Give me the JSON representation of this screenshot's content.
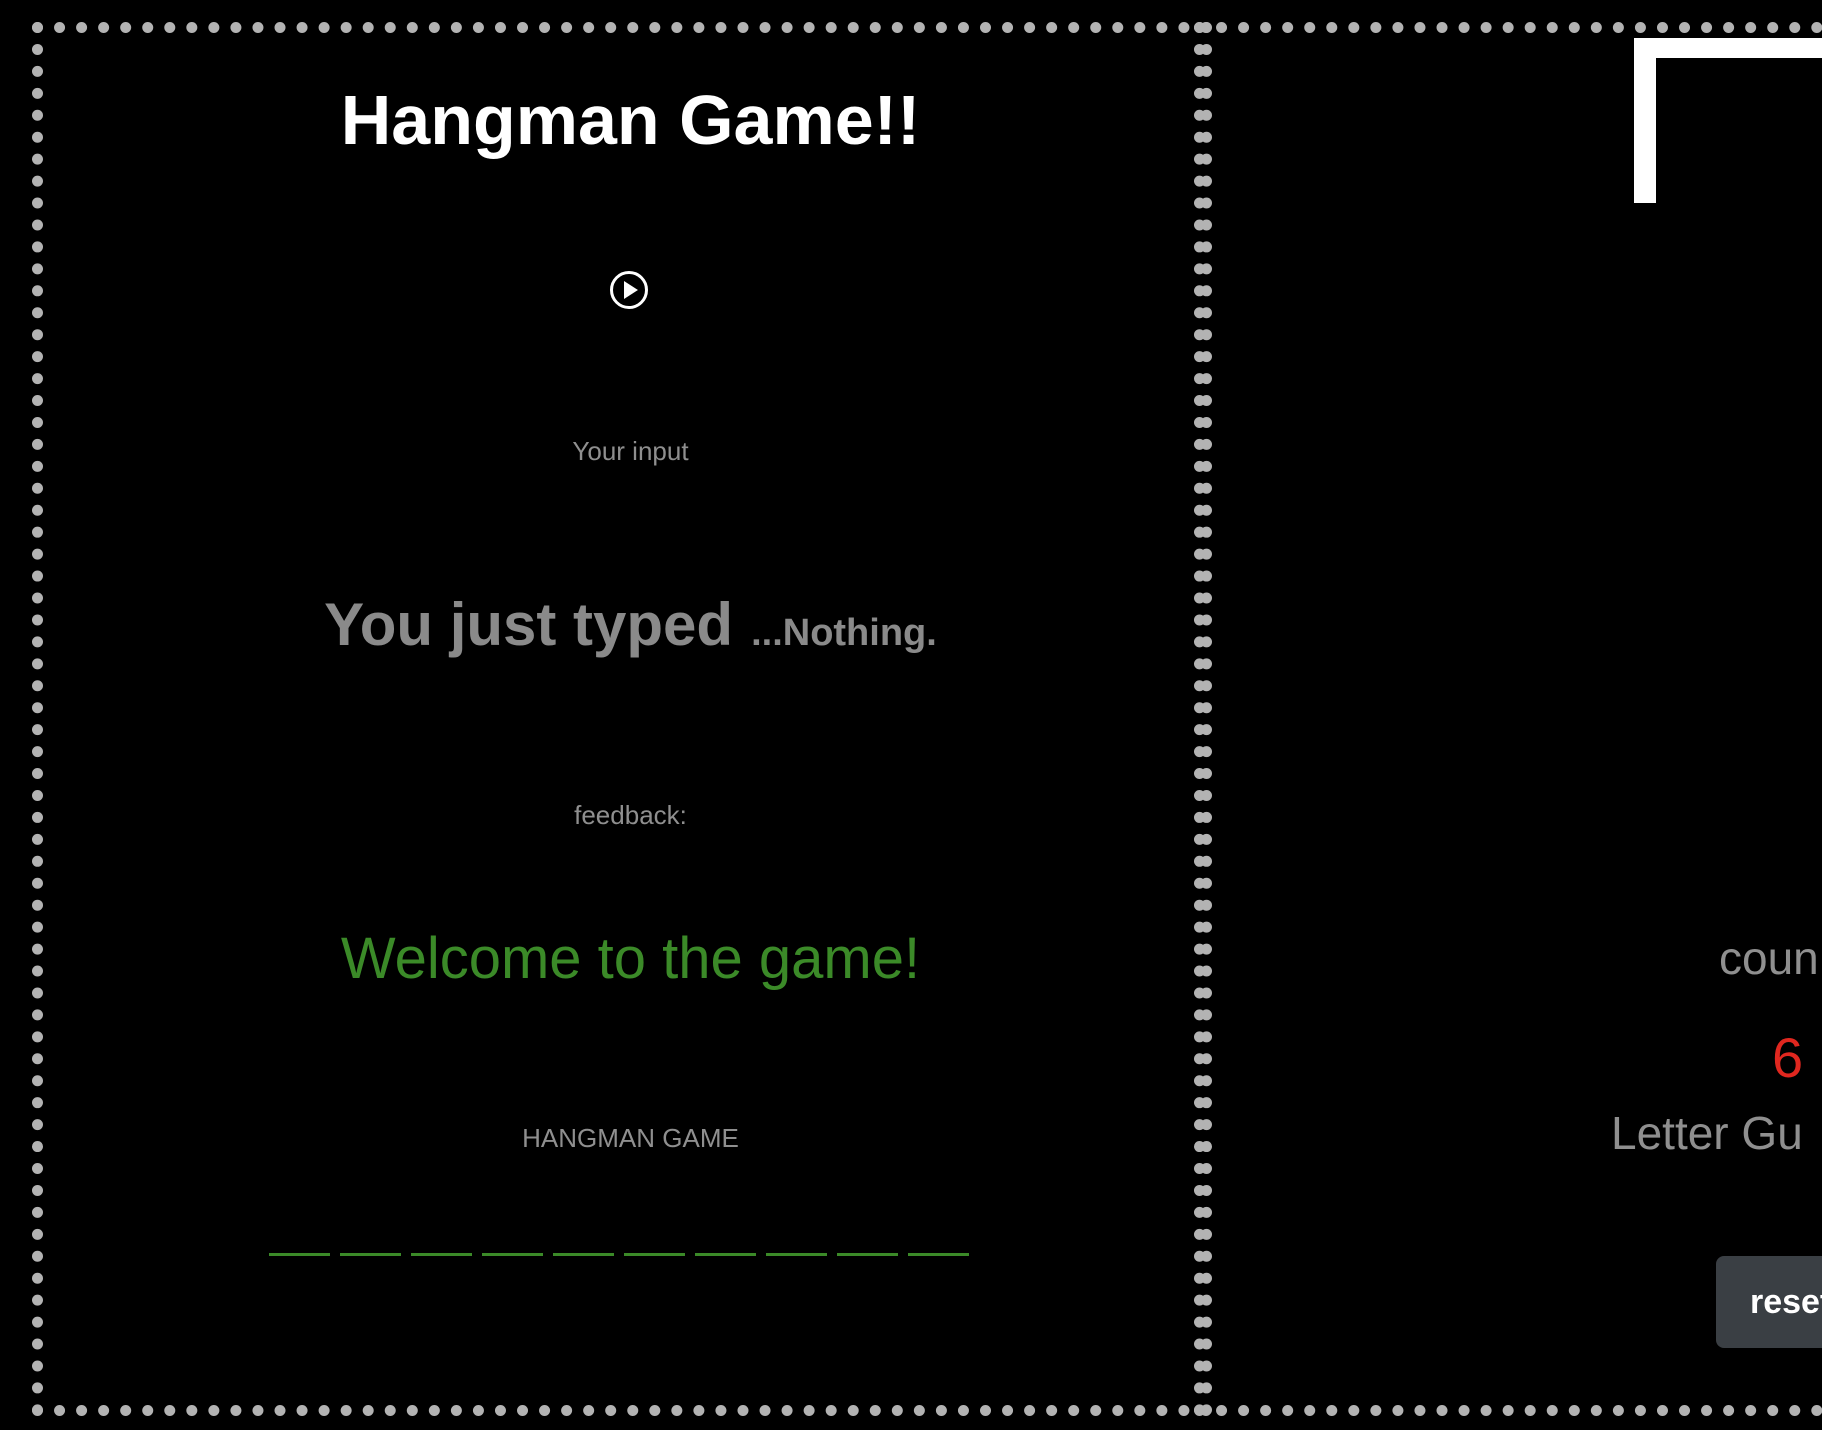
{
  "header": {
    "title": "Hangman Game!!"
  },
  "audio": {
    "play_icon": "play-circle-icon"
  },
  "input_section": {
    "label": "Your input",
    "typed_prefix": "You just typed",
    "typed_value": "...Nothing."
  },
  "feedback_section": {
    "label": "feedback:",
    "message": "Welcome to the game!",
    "message_color": "#3b8a28"
  },
  "word_section": {
    "label": "HANGMAN GAME",
    "blank_count": 10,
    "blank_color": "#3b8a28"
  },
  "stats": {
    "count_label": "coun",
    "count_value": "6",
    "count_color": "#e0271f",
    "guess_label": "Letter Gu"
  },
  "controls": {
    "reset_label": "reset"
  },
  "colors": {
    "background": "#000000",
    "border_dots": "#b3b3b3",
    "muted_text": "#8f8f8f"
  }
}
